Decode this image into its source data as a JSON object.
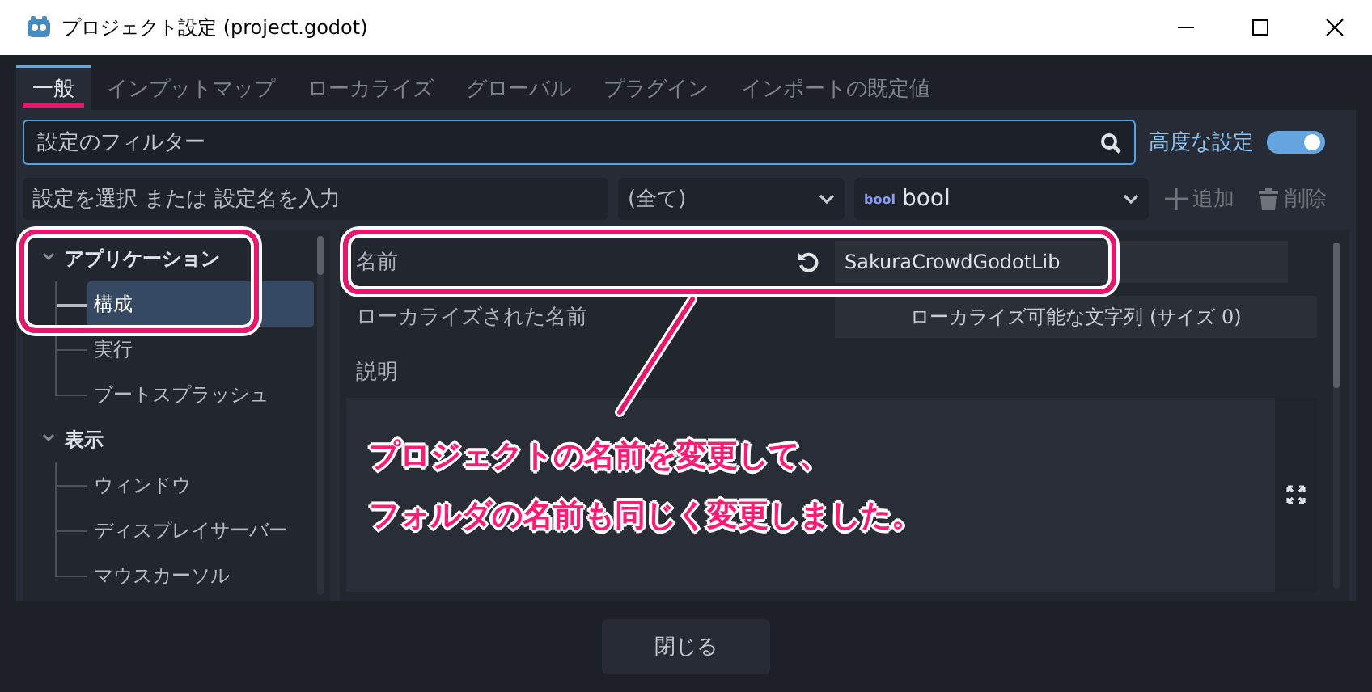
{
  "window": {
    "title": "プロジェクト設定 (project.godot)"
  },
  "tabs": [
    {
      "label": "一般",
      "selected": true
    },
    {
      "label": "インプットマップ",
      "selected": false
    },
    {
      "label": "ローカライズ",
      "selected": false
    },
    {
      "label": "グローバル",
      "selected": false
    },
    {
      "label": "プラグイン",
      "selected": false
    },
    {
      "label": "インポートの既定値",
      "selected": false
    }
  ],
  "filter": {
    "placeholder": "設定のフィルター"
  },
  "advanced": {
    "label": "高度な設定",
    "on": true
  },
  "property_path": {
    "placeholder": "設定を選択 または 設定名を入力"
  },
  "category_select": {
    "value": "(全て)"
  },
  "type_select": {
    "badge": "bool",
    "value": "bool"
  },
  "add_button": {
    "label": "追加",
    "disabled": true
  },
  "delete_button": {
    "label": "削除",
    "disabled": true
  },
  "tree": [
    {
      "label": "アプリケーション",
      "expanded": true,
      "children": [
        {
          "label": "構成",
          "selected": true
        },
        {
          "label": "実行",
          "selected": false
        },
        {
          "label": "ブートスプラッシュ",
          "selected": false
        }
      ]
    },
    {
      "label": "表示",
      "expanded": true,
      "children": [
        {
          "label": "ウィンドウ",
          "selected": false
        },
        {
          "label": "ディスプレイサーバー",
          "selected": false
        },
        {
          "label": "マウスカーソル",
          "selected": false
        }
      ]
    }
  ],
  "properties": [
    {
      "kind": "text",
      "label": "名前",
      "value": "SakuraCrowdGodotLib",
      "revertable": true
    },
    {
      "kind": "localized",
      "label": "ローカライズされた名前",
      "value": "ローカライズ可能な文字列 (サイズ 0)"
    },
    {
      "kind": "multiline",
      "label": "説明"
    }
  ],
  "annotation": {
    "lines": [
      "プロジェクトの名前を変更して、",
      "フォルダの名前も同じく変更しました。"
    ]
  },
  "close_button": {
    "label": "閉じる"
  }
}
